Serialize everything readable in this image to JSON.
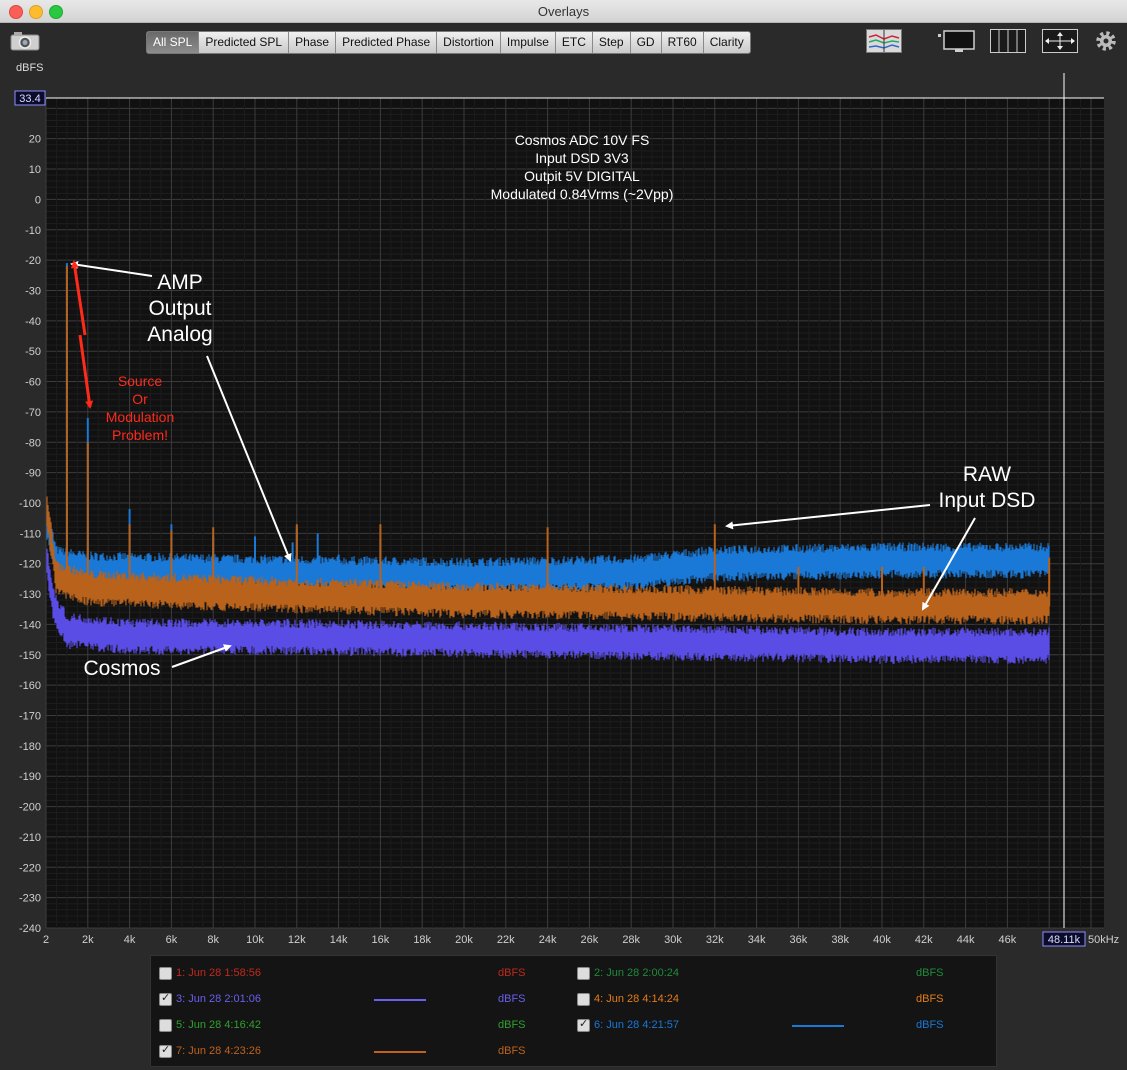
{
  "window": {
    "title": "Overlays"
  },
  "tabs": [
    "All SPL",
    "Predicted SPL",
    "Phase",
    "Predicted Phase",
    "Distortion",
    "Impulse",
    "ETC",
    "Step",
    "GD",
    "RT60",
    "Clarity"
  ],
  "active_tab": "All SPL",
  "y_unit": "dBFS",
  "cursor": {
    "y_readout": "33.4",
    "x_readout": "48.11k"
  },
  "chart_data": {
    "type": "line",
    "title": "",
    "info_text": [
      "Cosmos ADC 10V FS",
      "Input DSD 3V3",
      "Outpit 5V DIGITAL",
      "Modulated 0.84Vrms (~2Vpp)"
    ],
    "ylabel": "dBFS",
    "xlabel": "",
    "ylim": [
      -240,
      30
    ],
    "xlim": [
      2,
      50000
    ],
    "y_ticks": [
      20,
      10,
      0,
      -10,
      -20,
      -30,
      -40,
      -50,
      -60,
      -70,
      -80,
      -90,
      -100,
      -110,
      -120,
      -130,
      -140,
      -150,
      -160,
      -170,
      -180,
      -190,
      -200,
      -210,
      -220,
      -230,
      -240
    ],
    "x_ticks": [
      2,
      2000,
      4000,
      6000,
      8000,
      10000,
      12000,
      14000,
      16000,
      18000,
      20000,
      22000,
      24000,
      26000,
      28000,
      30000,
      32000,
      34000,
      36000,
      38000,
      40000,
      42000,
      44000,
      46000,
      50000
    ],
    "x_tick_labels": [
      "2",
      "2k",
      "4k",
      "6k",
      "8k",
      "10k",
      "12k",
      "14k",
      "16k",
      "18k",
      "20k",
      "22k",
      "24k",
      "26k",
      "28k",
      "30k",
      "32k",
      "34k",
      "36k",
      "38k",
      "40k",
      "42k",
      "44k",
      "46k",
      "50kHz"
    ],
    "grid": true,
    "series": [
      {
        "name": "6: Jun 28 4:21:57",
        "color": "#1a78d6",
        "floor": [
          [
            2,
            -105
          ],
          [
            500,
            -120
          ],
          [
            2000,
            -122
          ],
          [
            10000,
            -123
          ],
          [
            20000,
            -124
          ],
          [
            28000,
            -123
          ],
          [
            32000,
            -120
          ],
          [
            40000,
            -119
          ],
          [
            48000,
            -119
          ]
        ],
        "peaks": [
          [
            1000,
            -21
          ],
          [
            2000,
            -72
          ],
          [
            4000,
            -102
          ],
          [
            6000,
            -107
          ],
          [
            8000,
            -111
          ],
          [
            10000,
            -111
          ],
          [
            11800,
            -113
          ],
          [
            12000,
            -108
          ],
          [
            13000,
            -110
          ],
          [
            14000,
            -117
          ],
          [
            16000,
            -112
          ]
        ]
      },
      {
        "name": "7: Jun 28 4:23:26",
        "color": "#b8621c",
        "floor": [
          [
            2,
            -100
          ],
          [
            500,
            -125
          ],
          [
            2000,
            -128
          ],
          [
            10000,
            -130
          ],
          [
            20000,
            -132
          ],
          [
            30000,
            -133
          ],
          [
            40000,
            -134
          ],
          [
            48000,
            -134
          ]
        ],
        "peaks": [
          [
            1000,
            -22
          ],
          [
            2000,
            -80
          ],
          [
            4000,
            -107
          ],
          [
            6000,
            -109
          ],
          [
            8000,
            -108
          ],
          [
            12000,
            -107
          ],
          [
            16000,
            -107
          ],
          [
            24000,
            -108
          ],
          [
            32000,
            -107
          ],
          [
            36000,
            -121
          ],
          [
            40000,
            -121
          ],
          [
            42000,
            -121
          ],
          [
            48000,
            -118
          ]
        ]
      },
      {
        "name": "3: Jun 28 2:01:06",
        "color": "#5a4de6",
        "floor": [
          [
            2,
            -118
          ],
          [
            400,
            -135
          ],
          [
            1000,
            -142
          ],
          [
            4000,
            -144
          ],
          [
            10000,
            -144
          ],
          [
            20000,
            -145
          ],
          [
            30000,
            -146
          ],
          [
            40000,
            -147
          ],
          [
            48000,
            -147
          ]
        ],
        "peaks": []
      }
    ],
    "annotations": [
      {
        "text": "AMP\nOutput\nAnalog",
        "color": "#ffffff"
      },
      {
        "text": "Source\nOr\nModulation\nProblem!",
        "color": "#ff2a1a"
      },
      {
        "text": "RAW\nInput DSD",
        "color": "#ffffff"
      },
      {
        "text": "Cosmos",
        "color": "#ffffff"
      }
    ]
  },
  "legend": [
    {
      "label": "1: Jun 28 1:58:56",
      "unit": "dBFS",
      "color": "#c0291d",
      "checked": false,
      "swatch": false
    },
    {
      "label": "2: Jun 28 2:00:24",
      "unit": "dBFS",
      "color": "#1f8a3a",
      "checked": false,
      "swatch": false
    },
    {
      "label": "3: Jun 28 2:01:06",
      "unit": "dBFS",
      "color": "#6a5ff0",
      "checked": true,
      "swatch": true
    },
    {
      "label": "4: Jun 28 4:14:24",
      "unit": "dBFS",
      "color": "#e37b1a",
      "checked": false,
      "swatch": false
    },
    {
      "label": "5: Jun 28 4:16:42",
      "unit": "dBFS",
      "color": "#2fa02f",
      "checked": false,
      "swatch": false
    },
    {
      "label": "6: Jun 28 4:21:57",
      "unit": "dBFS",
      "color": "#1a78d6",
      "checked": true,
      "swatch": true
    },
    {
      "label": "7: Jun 28 4:23:26",
      "unit": "dBFS",
      "color": "#c0621c",
      "checked": true,
      "swatch": true
    }
  ]
}
